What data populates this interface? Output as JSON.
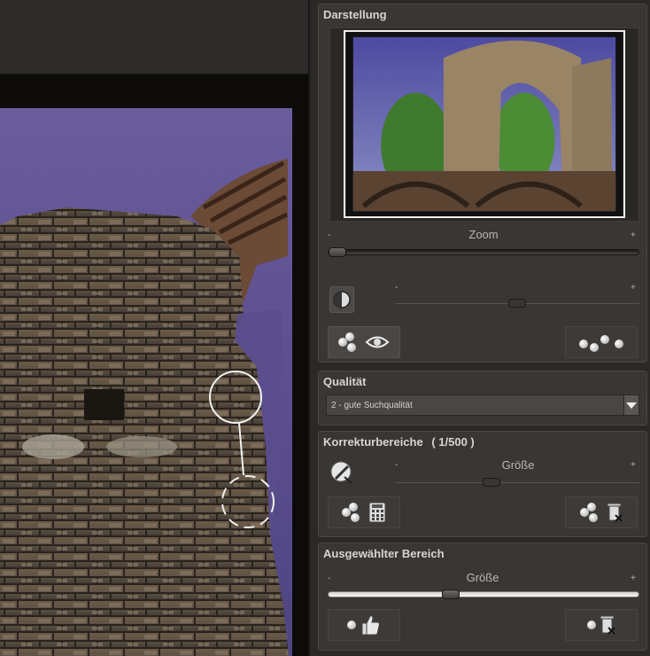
{
  "sections": {
    "darstellung": {
      "title": "Darstellung",
      "zoom_label": "Zoom",
      "minus": "-",
      "plus": "+",
      "zoom_value": 0.0,
      "compare_value": 0.55
    },
    "qualitaet": {
      "title": "Qualität",
      "selected": "2 - gute Suchqualität"
    },
    "korrektur": {
      "title": "Korrekturbereiche",
      "count": "( 1/500 )",
      "size_label": "Größe",
      "minus": "-",
      "plus": "+"
    },
    "ausgewaehlt": {
      "title": "Ausgewählter Bereich",
      "size_label": "Größe",
      "minus": "-",
      "plus": "+",
      "size_value": 0.4
    }
  }
}
